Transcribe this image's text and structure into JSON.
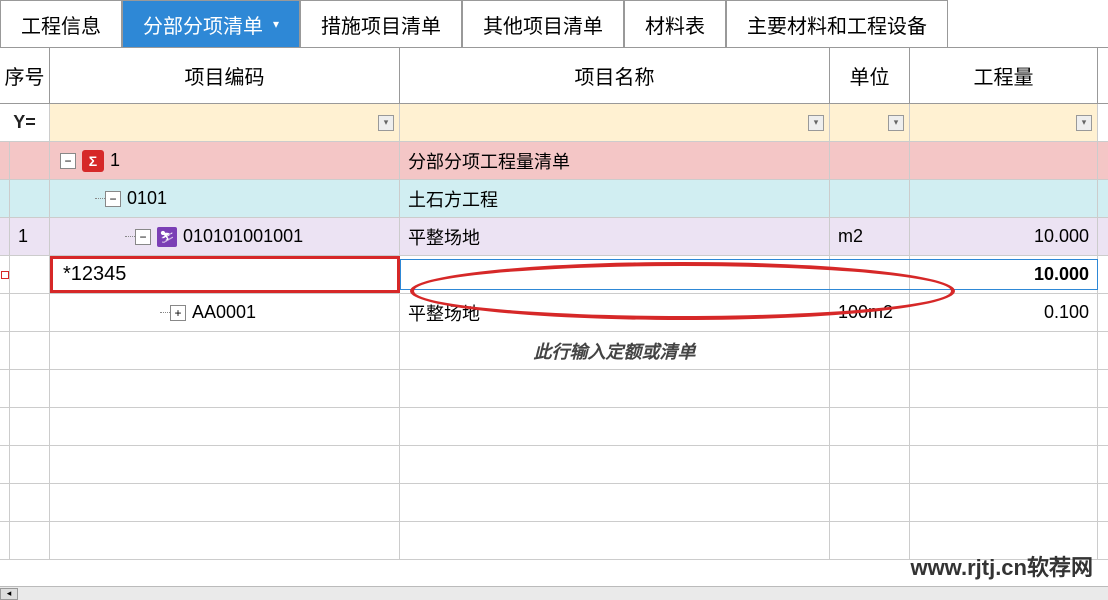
{
  "tabs": [
    {
      "label": "工程信息"
    },
    {
      "label": "分部分项清单",
      "active": true,
      "hasDropdown": true
    },
    {
      "label": "措施项目清单"
    },
    {
      "label": "其他项目清单"
    },
    {
      "label": "材料表"
    },
    {
      "label": "主要材料和工程设备"
    }
  ],
  "columns": {
    "seq": "序号",
    "code": "项目编码",
    "name": "项目名称",
    "unit": "单位",
    "qty": "工程量"
  },
  "filter_icon": "Y=",
  "rows": [
    {
      "type": "group1",
      "code": "1",
      "name": "分部分项工程量清单",
      "unit": "",
      "qty": ""
    },
    {
      "type": "group2",
      "code": "0101",
      "name": "土石方工程",
      "unit": "",
      "qty": ""
    },
    {
      "type": "item",
      "seq": "1",
      "code": "010101001001",
      "name": "平整场地",
      "unit": "m2",
      "qty": "10.000"
    },
    {
      "type": "selected",
      "code": "*12345",
      "name": "",
      "unit": "",
      "qty": "10.000"
    },
    {
      "type": "sub",
      "code": "AA0001",
      "name": "平整场地",
      "unit": "100m2",
      "qty": "0.100"
    },
    {
      "type": "hint",
      "hint": "此行输入定额或清单"
    }
  ],
  "watermark": "www.rjtj.cn软荐网",
  "icons": {
    "sigma": "Σ",
    "toggle_minus": "−",
    "toggle_plus": "+",
    "dropdown": "▾",
    "person": "⛷"
  }
}
